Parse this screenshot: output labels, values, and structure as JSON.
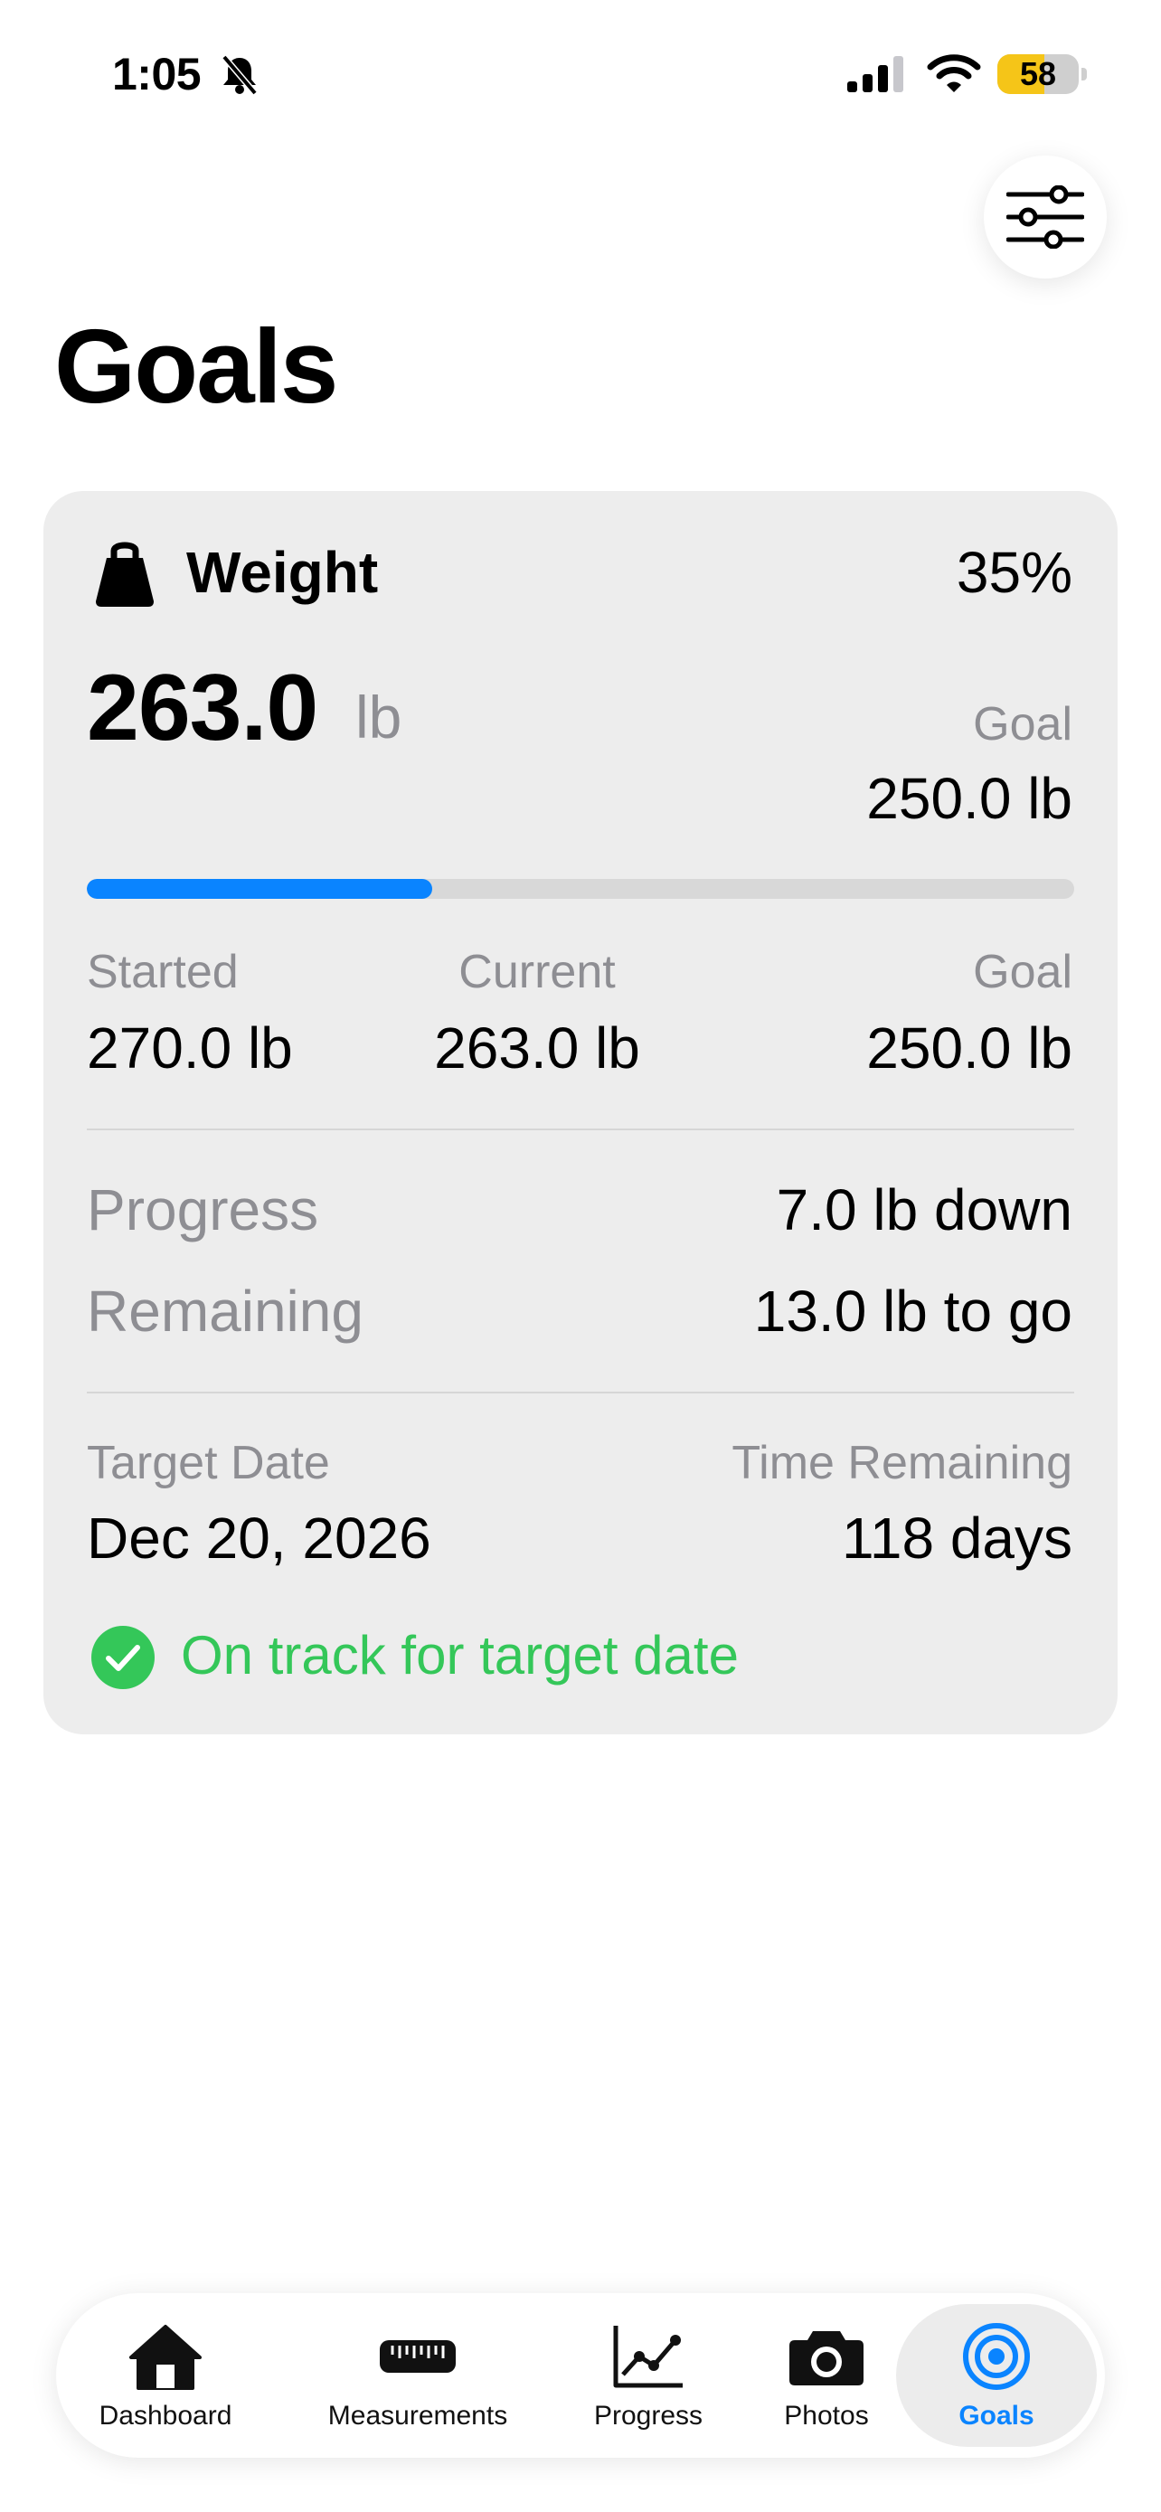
{
  "status_bar": {
    "time": "1:05",
    "battery_percent": "58",
    "battery_level": 0.58,
    "icons": [
      "bell-slash-icon",
      "cellular-signal-icon",
      "wifi-icon",
      "battery-icon"
    ]
  },
  "header": {
    "title": "Goals",
    "filter_icon": "sliders-icon"
  },
  "goal_card": {
    "icon": "kettlebell-icon",
    "title": "Weight",
    "percent": "35%",
    "progress_fraction": 0.35,
    "current_value": "263.0",
    "current_unit": "lb",
    "goal_label": "Goal",
    "goal_value": "250.0 lb",
    "stats": [
      {
        "label": "Started",
        "value": "270.0 lb"
      },
      {
        "label": "Current",
        "value": "263.0 lb"
      },
      {
        "label": "Goal",
        "value": "250.0 lb"
      }
    ],
    "progress_label": "Progress",
    "progress_value": "7.0 lb down",
    "remaining_label": "Remaining",
    "remaining_value": "13.0 lb to go",
    "target_date_label": "Target Date",
    "target_date_value": "Dec 20, 2026",
    "time_remaining_label": "Time Remaining",
    "time_remaining_value": "118 days",
    "status_text": "On track for target date",
    "status_icon": "checkmark-circle-icon",
    "status_color": "#34c759",
    "accent_color": "#0a84ff"
  },
  "tab_bar": {
    "tabs": [
      {
        "label": "Dashboard",
        "icon": "house-icon",
        "active": false
      },
      {
        "label": "Measurements",
        "icon": "ruler-icon",
        "active": false
      },
      {
        "label": "Progress",
        "icon": "line-chart-icon",
        "active": false
      },
      {
        "label": "Photos",
        "icon": "camera-icon",
        "active": false
      },
      {
        "label": "Goals",
        "icon": "target-icon",
        "active": true
      }
    ]
  }
}
